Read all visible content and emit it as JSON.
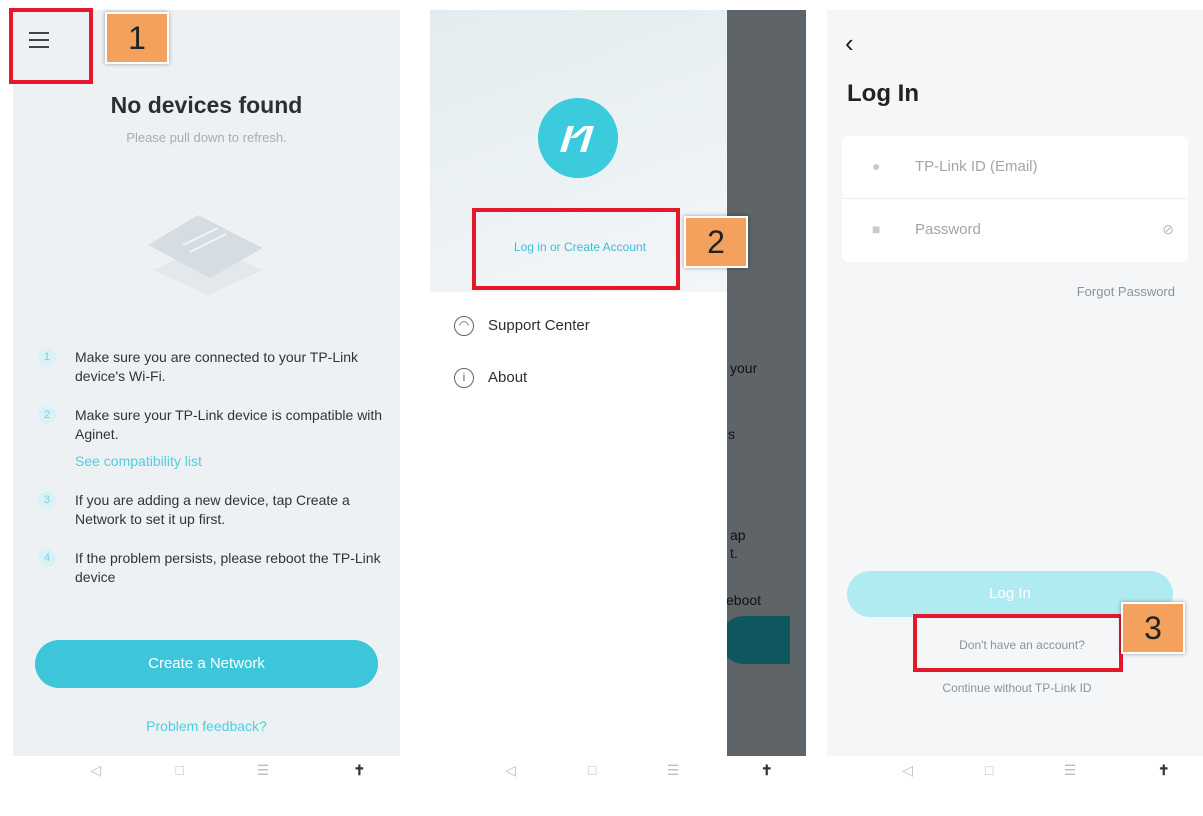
{
  "panel1": {
    "title": "No devices found",
    "subtitle": "Please pull down to refresh.",
    "tips": [
      {
        "num": "1",
        "text": "Make sure you are connected to your TP-Link device's Wi-Fi."
      },
      {
        "num": "2",
        "text": "Make sure your TP-Link device is compatible with Aginet.",
        "link": "See compatibility list"
      },
      {
        "num": "3",
        "text": "If you are adding a new device, tap Create a Network to set it up first."
      },
      {
        "num": "4",
        "text": "If the problem persists, please reboot the TP-Link device"
      }
    ],
    "create_button": "Create a Network",
    "feedback_link": "Problem feedback?"
  },
  "panel2": {
    "login_link": "Log in or Create Account",
    "menu": [
      {
        "label": "Support Center",
        "icon": "headset-icon"
      },
      {
        "label": "About",
        "icon": "info-icon"
      }
    ],
    "background_text": [
      "your",
      "s",
      "ap",
      "t.",
      "eboot"
    ]
  },
  "panel3": {
    "title": "Log In",
    "email_placeholder": "TP-Link ID (Email)",
    "password_placeholder": "Password",
    "forgot": "Forgot Password",
    "login_button": "Log In",
    "no_account": "Don't have an account?",
    "continue": "Continue without TP-Link ID"
  },
  "callouts": [
    "1",
    "2",
    "3"
  ],
  "nav": {
    "back": "◁",
    "home": "□",
    "menu": "☰",
    "accessibility": "✝"
  },
  "colors": {
    "accent": "#3dc6da",
    "highlight": "#e4182b",
    "badge": "#f3a15d"
  }
}
